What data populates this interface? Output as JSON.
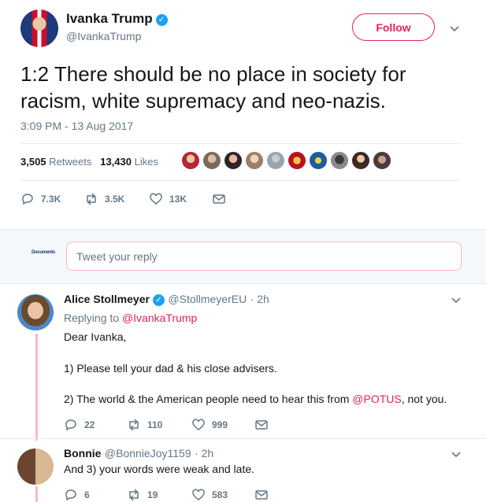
{
  "header": {
    "name": "Ivanka Trump",
    "handle": "@IvankaTrump",
    "follow_label": "Follow"
  },
  "tweet": {
    "text": "1:2 There should be no place in society for racism, white supremacy and neo-nazis.",
    "timestamp": "3:09 PM - 13 Aug 2017",
    "retweets_count": "3,505",
    "retweets_label": "Retweets",
    "likes_count": "13,430",
    "likes_label": "Likes",
    "actions": {
      "replies": "7.3K",
      "retweets": "3.5K",
      "likes": "13K"
    }
  },
  "reply_box": {
    "placeholder": "Tweet your reply",
    "logo_text": "Documents"
  },
  "replies": [
    {
      "name": "Alice Stollmeyer",
      "handle": "@StollmeyerEU",
      "time": "· 2h",
      "replying_to_label": "Replying to",
      "replying_to": "@IvankaTrump",
      "line1": "Dear Ivanka,",
      "line2": "1) Please tell your dad & his close advisers.",
      "line3_pre": "2) The world & the American people need to hear this from",
      "line3_mention": "@POTUS",
      "line3_post": ", not you.",
      "actions": {
        "replies": "22",
        "retweets": "110",
        "likes": "999"
      }
    },
    {
      "name": "Bonnie",
      "handle": "@BonnieJoy1159",
      "time": "· 2h",
      "text": "And 3) your words were weak and late.",
      "actions": {
        "replies": "6",
        "retweets": "19",
        "likes": "583"
      }
    }
  ],
  "colors": {
    "accent": "#e0245e",
    "verified": "#1da1f2",
    "muted": "#657786"
  }
}
